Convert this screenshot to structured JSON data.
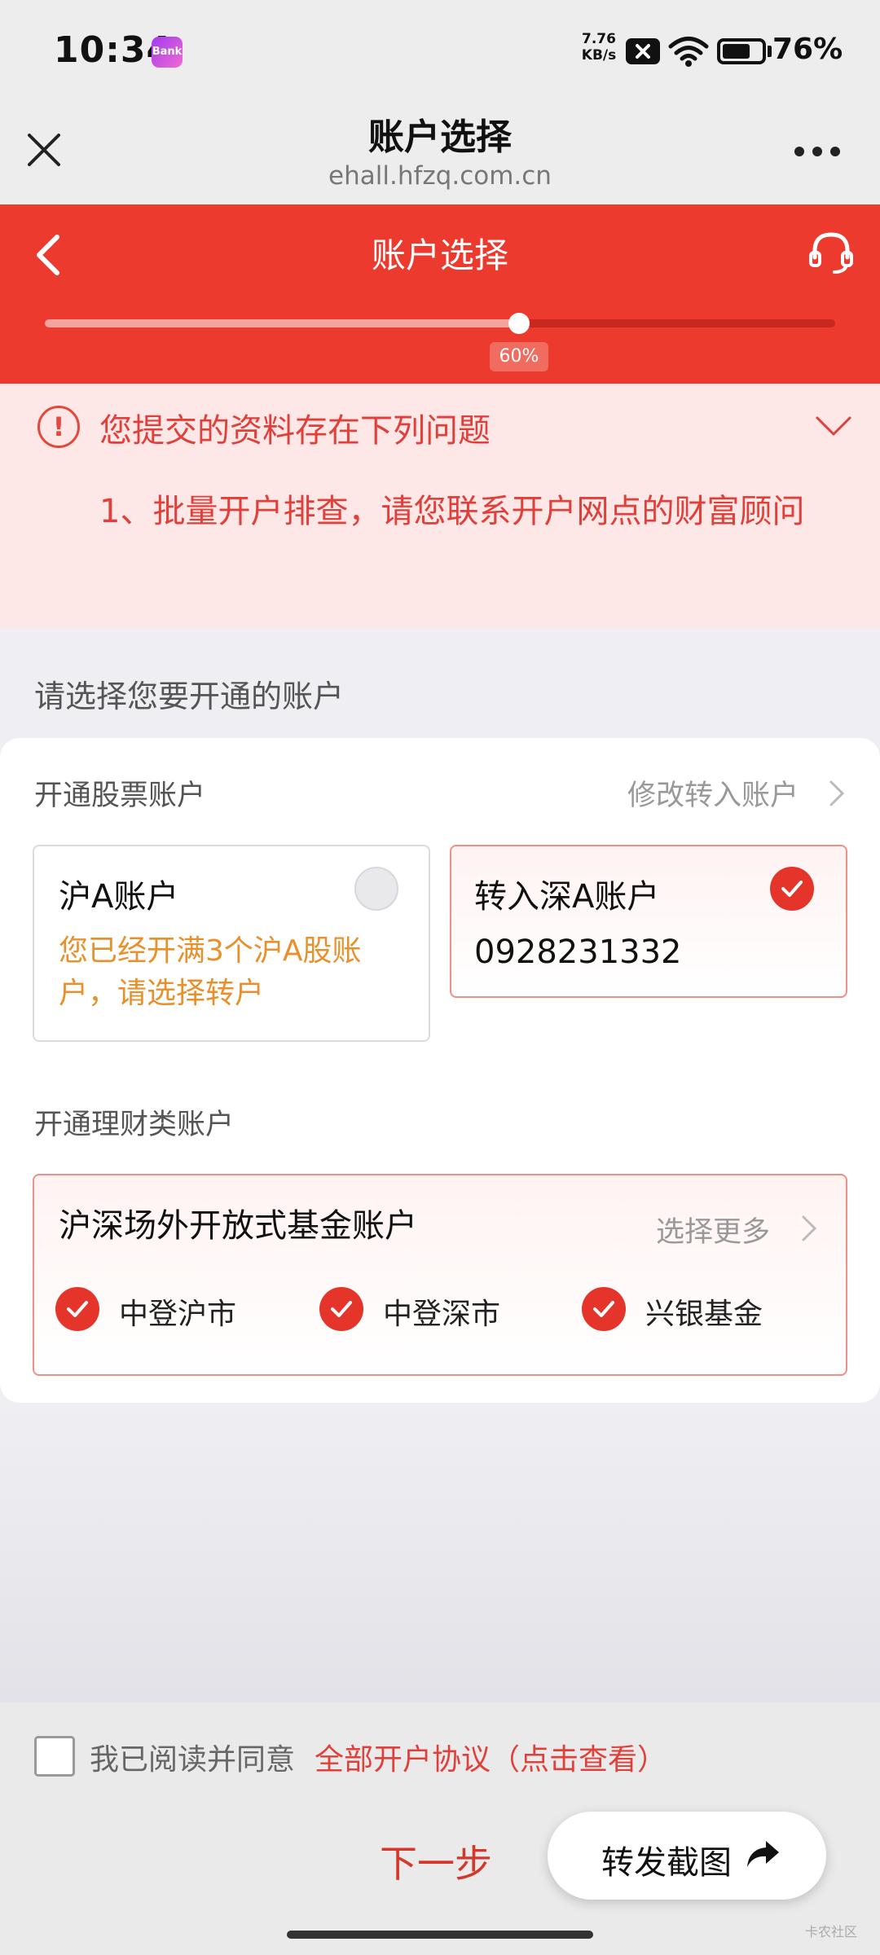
{
  "status_bar": {
    "time": "10:34",
    "app_badge": "Bank",
    "net_speed_value": "7.76",
    "net_speed_unit": "KB/s",
    "battery": "76%",
    "battery_level": 0.76
  },
  "browser": {
    "title": "账户选择",
    "url": "ehall.hfzq.com.cn",
    "close_icon": "close-icon",
    "more_icon": "more-icon"
  },
  "header": {
    "title": "账户选择",
    "back_icon": "back-icon",
    "service_icon": "headset-icon",
    "progress_value": 0.6,
    "progress_label": "60%",
    "color": "#ec3a2e"
  },
  "error": {
    "title": "您提交的资料存在下列问题",
    "item": "1、批量开户排查，请您联系开户网点的财富顾问",
    "icon": "!",
    "color": "#e0403a"
  },
  "section_title": "请选择您要开通的账户",
  "stock": {
    "label": "开通股票账户",
    "modify_link": "修改转入账户",
    "sh_account": {
      "title": "沪A账户",
      "note": "您已经开满3个沪A股账户，请选择转户",
      "selected": false
    },
    "sz_account": {
      "title": "转入深A账户",
      "account_number": "0928231332",
      "selected": true
    }
  },
  "wealth": {
    "label": "开通理财类账户",
    "fund_card": {
      "title": "沪深场外开放式基金账户",
      "more": "选择更多",
      "options": [
        {
          "label": "中登沪市",
          "checked": true
        },
        {
          "label": "中登深市",
          "checked": true
        },
        {
          "label": "兴银基金",
          "checked": true
        }
      ]
    }
  },
  "footer": {
    "agree_text": "我已阅读并同意",
    "agree_link": "全部开户协议（点击查看）",
    "agree_checked": false,
    "next_label": "下一步",
    "share_label": "转发截图"
  },
  "watermark": "卡农社区"
}
